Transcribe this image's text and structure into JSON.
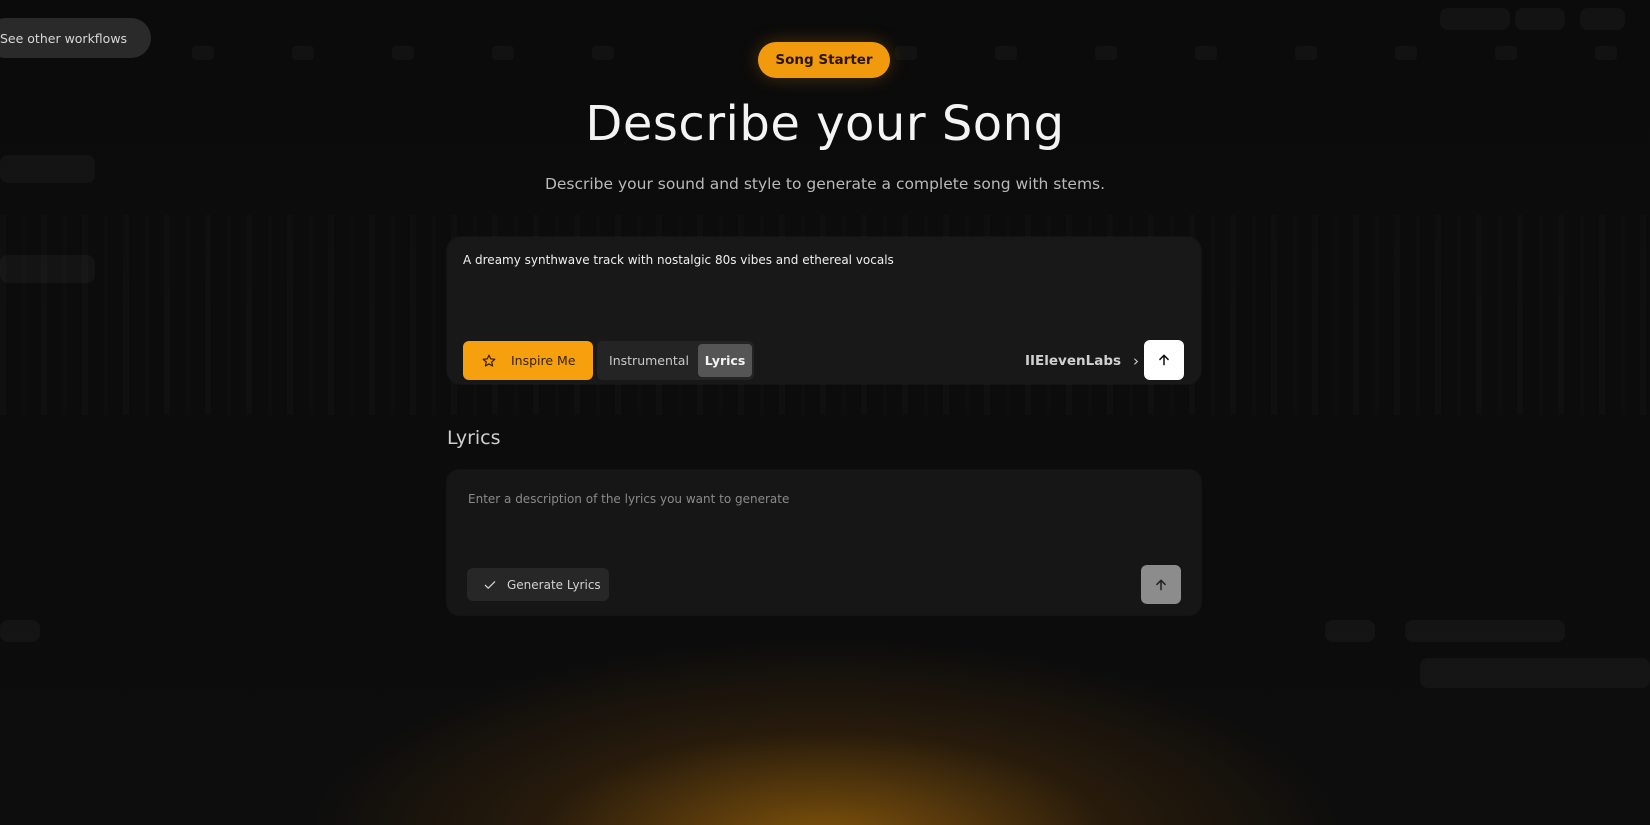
{
  "workflows": {
    "label": "See other workflows"
  },
  "badge": {
    "label": "Song Starter"
  },
  "header": {
    "title": "Describe your Song",
    "subtitle": "Describe your sound and style to generate a complete song with stems."
  },
  "prompt": {
    "value": "A dreamy synthwave track with nostalgic 80s vibes and ethereal vocals",
    "inspire_label": "Inspire Me",
    "mode_options": [
      "Instrumental",
      "Lyrics"
    ],
    "mode_selected": "Lyrics",
    "brand": "IIElevenLabs",
    "submit_icon": "arrow-up-icon"
  },
  "lyrics": {
    "heading": "Lyrics",
    "placeholder": "Enter a description of the lyrics you want to generate",
    "generate_label": "Generate Lyrics",
    "submit_icon": "arrow-up-icon"
  },
  "colors": {
    "accent": "#f5a00c",
    "background": "#0a0a0a",
    "card": "#181818"
  }
}
